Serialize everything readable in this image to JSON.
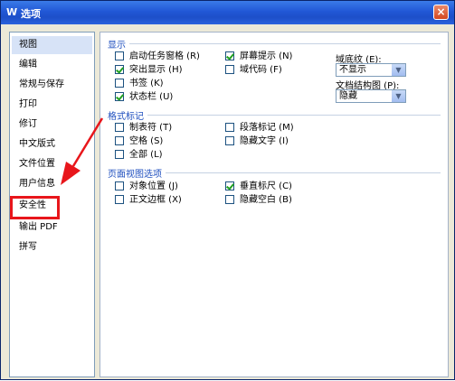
{
  "window": {
    "title": "选项",
    "app_icon": "W",
    "close_glyph": "×"
  },
  "sidebar": {
    "items": [
      {
        "label": "视图",
        "selected": true
      },
      {
        "label": "编辑"
      },
      {
        "label": "常规与保存"
      },
      {
        "label": "打印"
      },
      {
        "label": "修订"
      },
      {
        "label": "中文版式"
      },
      {
        "label": "文件位置"
      },
      {
        "label": "用户信息"
      },
      {
        "label": "安全性",
        "highlighted": true
      },
      {
        "label": "输出 PDF"
      },
      {
        "label": "拼写"
      }
    ]
  },
  "display": {
    "title": "显示",
    "checkboxes": [
      {
        "label": "启动任务窗格 (R)",
        "checked": false
      },
      {
        "label": "屏幕提示 (N)",
        "checked": true
      },
      {
        "label": "突出显示 (H)",
        "checked": true
      },
      {
        "label": "域代码 (F)",
        "checked": false
      },
      {
        "label": "书签 (K)",
        "checked": false
      },
      {
        "label": "状态栏 (U)",
        "checked": true
      }
    ],
    "field_shading": {
      "label": "域底纹 (E):",
      "value": "不显示"
    },
    "doc_map": {
      "label": "文档结构图 (P):",
      "value": "隐藏"
    }
  },
  "format_marks": {
    "title": "格式标记",
    "checkboxes": [
      {
        "label": "制表符 (T)",
        "checked": false
      },
      {
        "label": "段落标记 (M)",
        "checked": false
      },
      {
        "label": "空格 (S)",
        "checked": false
      },
      {
        "label": "隐藏文字 (I)",
        "checked": false
      },
      {
        "label": "全部 (L)",
        "checked": false
      }
    ]
  },
  "page_view": {
    "title": "页面视图选项",
    "checkboxes": [
      {
        "label": "对象位置 (J)",
        "checked": false
      },
      {
        "label": "垂直标尺 (C)",
        "checked": true
      },
      {
        "label": "正文边框 (X)",
        "checked": false
      },
      {
        "label": "隐藏空白 (B)",
        "checked": false
      }
    ]
  },
  "colors": {
    "accent": "#1f4fbf",
    "highlight": "#e8161b",
    "title_bar": "#2157d6"
  },
  "icons": {
    "close": "close-icon",
    "dropdown": "chevron-down-icon",
    "annotation": "red-arrow"
  }
}
